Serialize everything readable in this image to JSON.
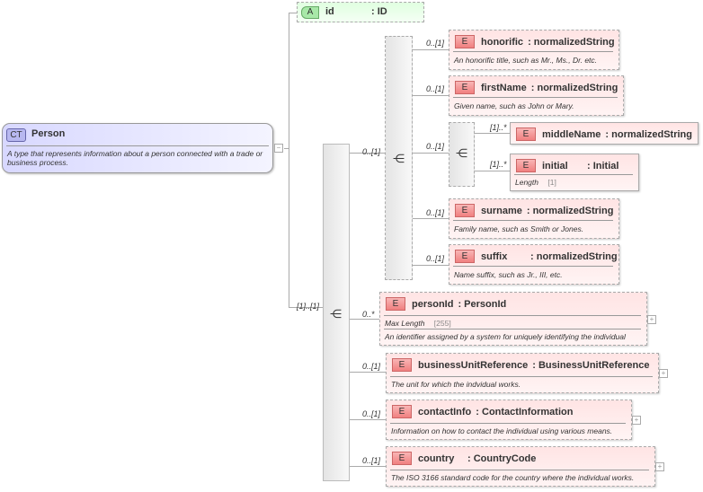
{
  "person": {
    "badge": "CT",
    "name": "Person",
    "doc": "A type that represents information about a person connected with a trade or business process.",
    "collapse": "−"
  },
  "attribute": {
    "badge": "A",
    "name": "id",
    "type": ": ID"
  },
  "compositor_labels": {
    "outer": "[1]..[1]",
    "inner": "0..[1]",
    "choice": "0..[1]"
  },
  "elements": [
    {
      "badge": "E",
      "name": "honorific",
      "type": ": normalizedString",
      "doc": "An honorific title, such as Mr., Ms., Dr. etc.",
      "mult": "0..[1]"
    },
    {
      "badge": "E",
      "name": "firstName",
      "type": ": normalizedString",
      "doc": "Given name, such as John or Mary.",
      "mult": "0..[1]"
    },
    {
      "badge": "E",
      "name": "middleName",
      "type": ": normalizedString",
      "mult": "[1]..*"
    },
    {
      "badge": "E",
      "name": "initial",
      "type": ": Initial",
      "facet": "Length",
      "facet_value": "[1]",
      "mult": "[1]..*"
    },
    {
      "badge": "E",
      "name": "surname",
      "type": ": normalizedString",
      "doc": "Family name, such as Smith or Jones.",
      "mult": "0..[1]"
    },
    {
      "badge": "E",
      "name": "suffix",
      "type": ": normalizedString",
      "doc": "Name suffix, such as Jr., III, etc.",
      "mult": "0..[1]"
    },
    {
      "badge": "E",
      "name": "personId",
      "type": ": PersonId",
      "facet": "Max Length",
      "facet_value": "[255]",
      "doc": "An identifier assigned by a system for uniquely identifying the individual",
      "mult": "0..*",
      "expand": "+"
    },
    {
      "badge": "E",
      "name": "businessUnitReference",
      "type": ": BusinessUnitReference",
      "doc": "The unit for which the indvidual works.",
      "mult": "0..[1]",
      "expand": "+"
    },
    {
      "badge": "E",
      "name": "contactInfo",
      "type": ": ContactInformation",
      "doc": "Information on how to contact the individual using various means.",
      "mult": "0..[1]",
      "expand": "+"
    },
    {
      "badge": "E",
      "name": "country",
      "type": ": CountryCode",
      "doc": "The ISO 3166 standard code for the country where the individual works.",
      "mult": "0..[1]",
      "expand": "+"
    }
  ]
}
